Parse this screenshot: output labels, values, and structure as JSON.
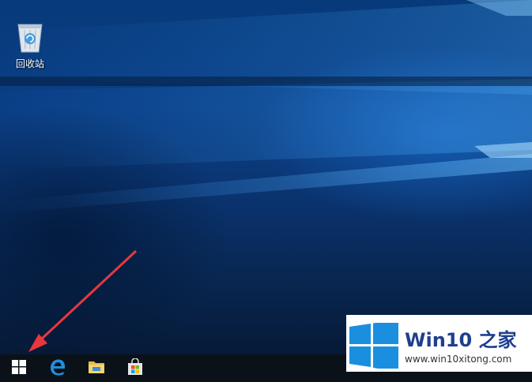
{
  "desktop": {
    "icons": [
      {
        "label": "回收站",
        "icon": "recycle-bin-icon"
      }
    ]
  },
  "taskbar": {
    "buttons": [
      {
        "icon": "windows-start-icon"
      },
      {
        "icon": "edge-browser-icon"
      },
      {
        "icon": "file-explorer-icon"
      },
      {
        "icon": "store-icon"
      }
    ]
  },
  "watermark": {
    "title": "Win10 之家",
    "url": "www.win10xitong.com"
  },
  "colors": {
    "annotation_arrow": "#e8383d",
    "windows_blue": "#1a8fe0",
    "watermark_blue": "#1f3f8f"
  }
}
